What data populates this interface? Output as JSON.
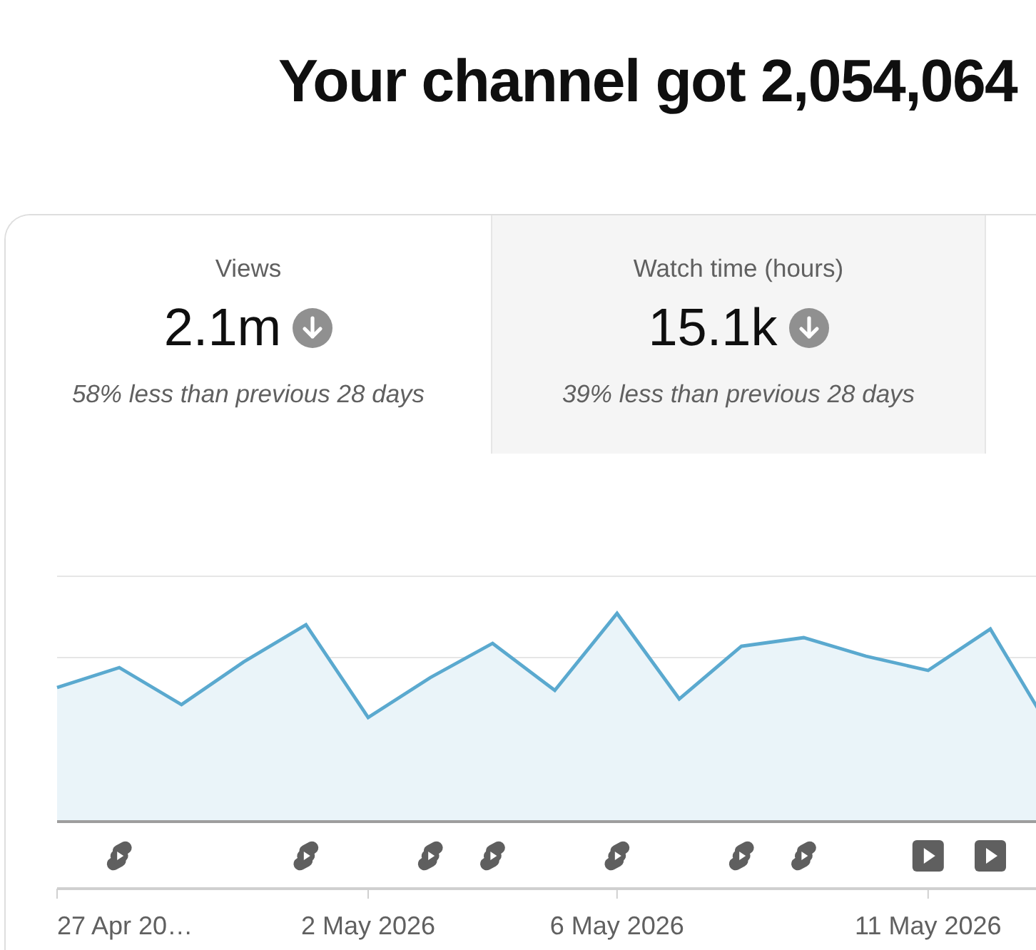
{
  "page": {
    "title": "Your channel got 2,054,064"
  },
  "tabs": [
    {
      "label": "Views",
      "value": "2.1m",
      "decreasing": true,
      "comparison": "58% less than previous 28 days",
      "selected": true
    },
    {
      "label": "Watch time (hours)",
      "value": "15.1k",
      "decreasing": true,
      "comparison": "39% less than previous 28 days",
      "selected": false
    }
  ],
  "chart": {
    "upload_markers": [
      {
        "kind": "none"
      },
      {
        "kind": "short"
      },
      {
        "kind": "none"
      },
      {
        "kind": "none"
      },
      {
        "kind": "short"
      },
      {
        "kind": "none"
      },
      {
        "kind": "short"
      },
      {
        "kind": "short"
      },
      {
        "kind": "none"
      },
      {
        "kind": "short"
      },
      {
        "kind": "none"
      },
      {
        "kind": "short"
      },
      {
        "kind": "short"
      },
      {
        "kind": "none"
      },
      {
        "kind": "video"
      },
      {
        "kind": "video"
      }
    ],
    "x_axis_labels": [
      "27 Apr 20…",
      "2 May 2026",
      "6 May 2026",
      "11 May 2026"
    ]
  }
}
